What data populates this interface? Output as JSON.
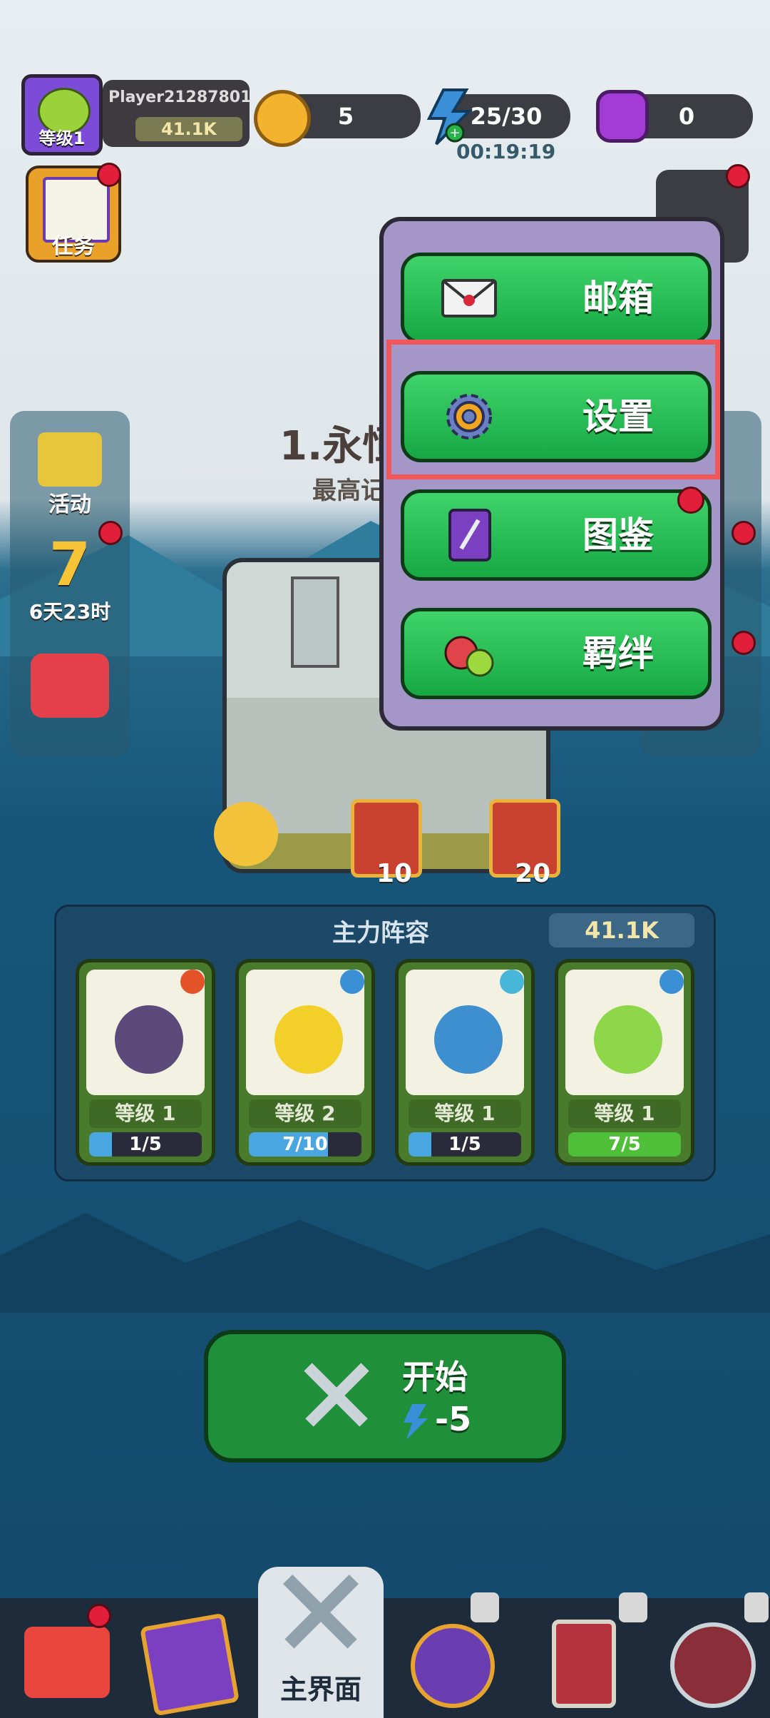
{
  "player": {
    "name": "Player21287801",
    "level_label": "等级1",
    "power": "41.1K"
  },
  "resources": {
    "coins": "5",
    "energy": "25/30",
    "energy_timer": "00:19:19",
    "gems": "0"
  },
  "quest": {
    "label": "任务"
  },
  "side_left": {
    "event_label": "活动",
    "countdown_label": "6天23时"
  },
  "stage": {
    "title": "1.永恒",
    "subtitle": "最高记",
    "chest_1": "10",
    "chest_2": "20"
  },
  "lineup": {
    "title": "主力阵容",
    "power": "41.1K",
    "cards": [
      {
        "level": "等级 1",
        "progress": "1/5",
        "fraction": 0.2,
        "creature_color": "#5c4a7a",
        "element_color": "#e4522a"
      },
      {
        "level": "等级 2",
        "progress": "7/10",
        "fraction": 0.7,
        "creature_color": "#f3cf2a",
        "element_color": "#3a8fd6"
      },
      {
        "level": "等级 1",
        "progress": "1/5",
        "fraction": 0.2,
        "creature_color": "#3e8fd0",
        "element_color": "#48b6d8"
      },
      {
        "level": "等级 1",
        "progress": "7/5",
        "fraction": 1.0,
        "creature_color": "#8ed64a",
        "element_color": "#3a8fd6"
      }
    ]
  },
  "start": {
    "label": "开始",
    "cost": "-5"
  },
  "nav": {
    "main_label": "主界面"
  },
  "menu": {
    "items": [
      {
        "label": "邮箱",
        "icon": "envelope-icon"
      },
      {
        "label": "设置",
        "icon": "gear-icon"
      },
      {
        "label": "图鉴",
        "icon": "book-icon"
      },
      {
        "label": "羁绊",
        "icon": "bond-icon"
      }
    ]
  },
  "colors": {
    "menu_button": "#23b94f",
    "highlight": "#f0575b",
    "popup": "#a497c7"
  }
}
